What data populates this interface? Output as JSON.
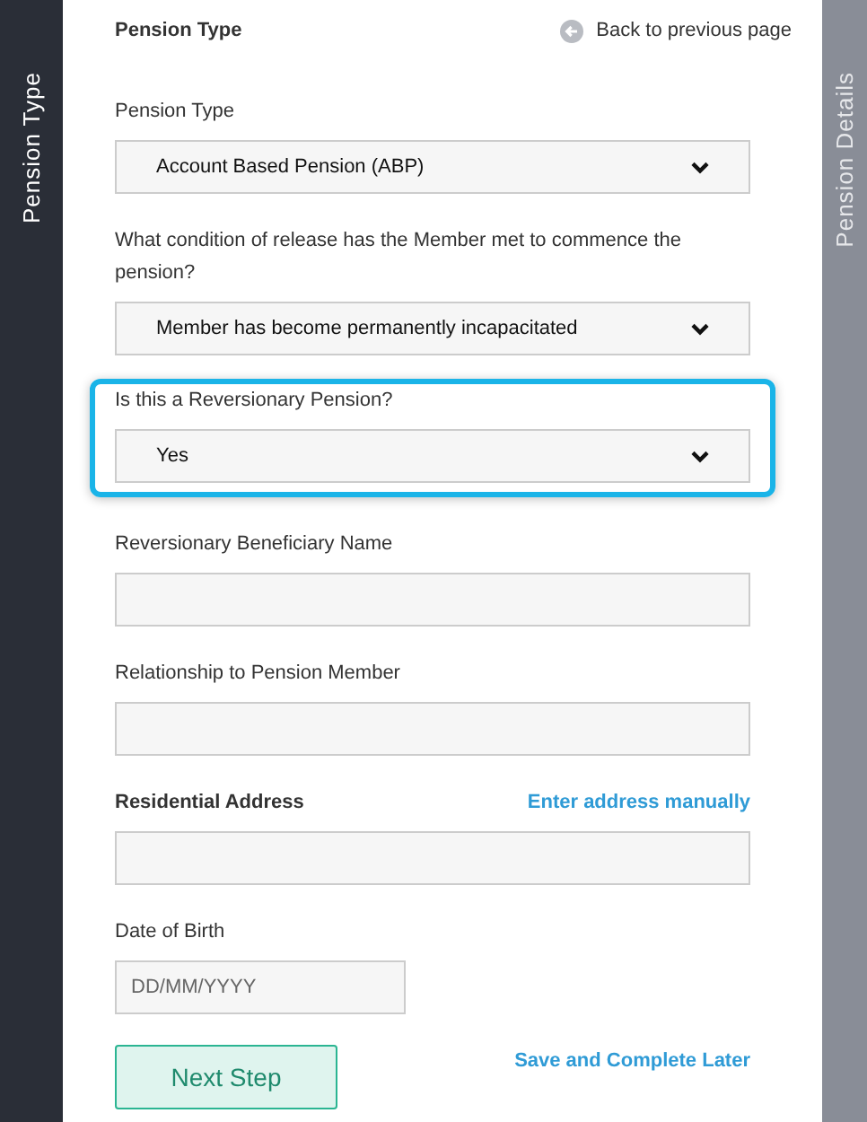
{
  "side_tabs": [
    {
      "label": "Pension Type",
      "selected": true
    },
    {
      "label": "Pension Details",
      "selected": false
    }
  ],
  "header": {
    "title": "Pension Type",
    "back_link": "Back to previous page"
  },
  "fields": [
    {
      "kind": "select",
      "label": "Pension Type",
      "value": "Account Based Pension (ABP)",
      "focused": false
    },
    {
      "kind": "select",
      "label": "What condition of release has the Member met to commence the pension?",
      "value": "Member has become permanently incapacitated",
      "focused": false
    },
    {
      "kind": "select",
      "label": "Is this a Reversionary Pension?",
      "value": "Yes",
      "focused": true
    },
    {
      "kind": "input",
      "label": "Reversionary Beneficiary Name",
      "focused": false
    },
    {
      "kind": "input",
      "label": "Relationship to Pension Member",
      "focused": false
    },
    {
      "kind": "address",
      "label": "Residential Address",
      "action": "Enter address manually",
      "focused": false
    },
    {
      "kind": "date",
      "label": "Date of Birth",
      "placeholder": "DD/MM/YYYY",
      "focused": false
    }
  ],
  "actions": {
    "next": "Next Step",
    "save_later": "Save and Complete Later"
  }
}
